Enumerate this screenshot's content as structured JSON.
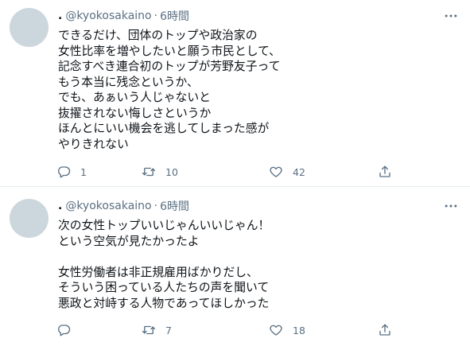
{
  "tweets": [
    {
      "display_name": ".",
      "handle": "@kyokosakaino",
      "separator": "·",
      "time": "6時間",
      "lines": [
        "できるだけ、団体のトップや政治家の",
        "女性比率を増やしたいと願う市民として、",
        "記念すべき連合初のトップが芳野友子って",
        "もう本当に残念というか、",
        "でも、あぁいう人じゃないと",
        "抜擢されない悔しさというか",
        "ほんとにいい機会を逃してしまった感が",
        "やりきれない"
      ],
      "reply_count": "1",
      "retweet_count": "10",
      "like_count": "42"
    },
    {
      "display_name": ".",
      "handle": "@kyokosakaino",
      "separator": "·",
      "time": "6時間",
      "lines": [
        "次の女性トップいいじゃんいいじゃん！",
        "という空気が見たかったよ",
        "",
        "女性労働者は非正規雇用ばかりだし、",
        "そういう困っている人たちの声を聞いて",
        "悪政と対峙する人物であってほしかった"
      ],
      "reply_count": "",
      "retweet_count": "7",
      "like_count": "18"
    }
  ],
  "icons": {
    "avatar": "default-avatar",
    "more": "more-icon",
    "reply": "reply-icon",
    "retweet": "retweet-icon",
    "like": "heart-icon",
    "share": "share-icon"
  },
  "colors": {
    "text": "#0f1419",
    "secondary": "#5b7083",
    "divider": "#e6ecf0",
    "avatar": "#ccd6dd"
  }
}
